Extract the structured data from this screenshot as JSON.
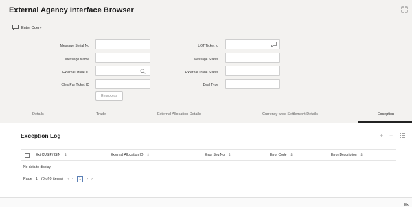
{
  "app": {
    "title": "External Agency Interface Browser",
    "enter_query": "Enter Query"
  },
  "form": {
    "message_serial_no": {
      "label": "Message Serial No",
      "value": ""
    },
    "message_name": {
      "label": "Message Name",
      "value": ""
    },
    "external_trade_id": {
      "label": "External Trade ID",
      "value": ""
    },
    "clearpar_ticket_id": {
      "label": "ClearPar Ticket ID",
      "value": ""
    },
    "lqt_ticket_id": {
      "label": "LQT Ticket Id",
      "value": ""
    },
    "message_status": {
      "label": "Message Status",
      "value": ""
    },
    "external_trade_status": {
      "label": "External Trade Status",
      "value": ""
    },
    "deal_type": {
      "label": "Deal Type",
      "value": ""
    },
    "reprocess_label": "Reprocess"
  },
  "tabs": [
    {
      "label": "Details"
    },
    {
      "label": "Trade"
    },
    {
      "label": "External Allocation Details"
    },
    {
      "label": "Currency wise Settlement Details"
    },
    {
      "label": "Exception"
    }
  ],
  "active_tab": "Exception",
  "exception_log": {
    "title": "Exception Log",
    "columns": [
      {
        "label": "Ext CUSIP/ ISIN"
      },
      {
        "label": "External Allocation ID"
      },
      {
        "label": "Error Seq No"
      },
      {
        "label": "Error Code"
      },
      {
        "label": "Error Description"
      }
    ],
    "sort_glyph": "⇕",
    "empty_text": "No data to display.",
    "pager": {
      "page_label": "Page",
      "page_number": "1",
      "items_text": "(0 of 0 items)",
      "current": "1",
      "first": "|‹",
      "prev": "‹",
      "next": "›",
      "last": "›|"
    }
  },
  "footer": {
    "exit_label": "Ex"
  },
  "icons": {
    "enter_query": "enter-query-icon",
    "search": "search-icon",
    "comment": "comment-icon",
    "add": "add-icon",
    "remove": "remove-icon",
    "columns": "columns-icon",
    "expand": "expand-icon"
  },
  "colors": {
    "panel_bg": "#f3f2f0",
    "active_tab_underline": "#222222",
    "pager_current_border": "#5a7fb5"
  }
}
